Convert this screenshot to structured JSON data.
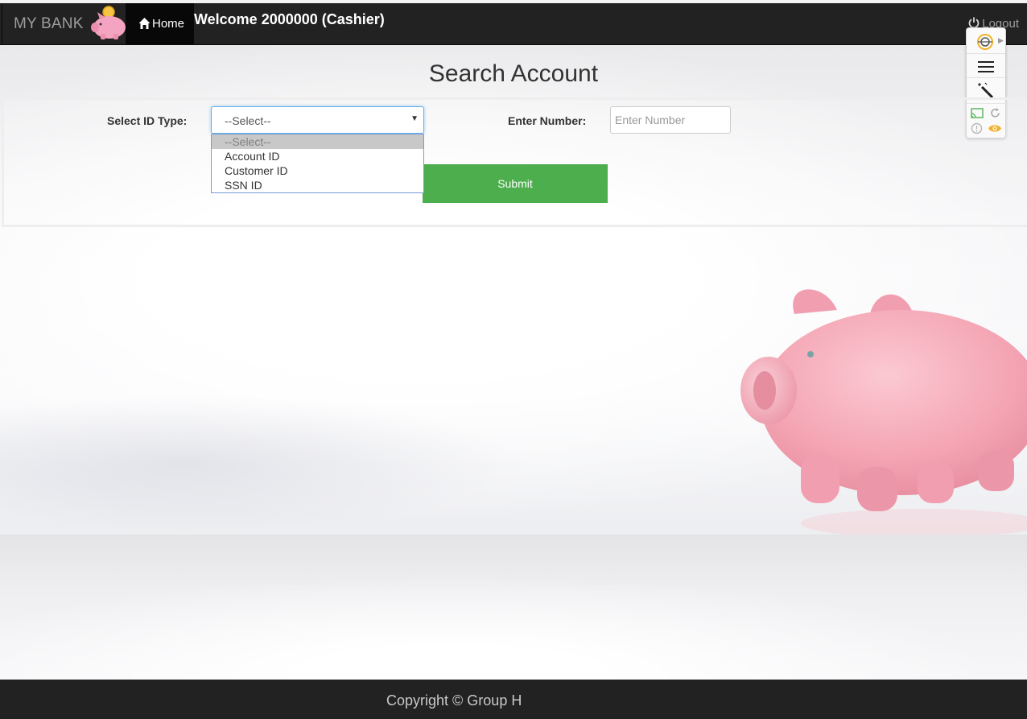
{
  "navbar": {
    "brand": "MY BANK",
    "home_label": "Home",
    "welcome": "Welcome 2000000 (Cashier)",
    "logout_label": "Logout"
  },
  "page": {
    "title": "Search Account"
  },
  "form": {
    "id_type_label": "Select ID Type:",
    "id_type_selected": "--Select--",
    "id_type_options": [
      "--Select--",
      "Account ID",
      "Customer ID",
      "SSN ID"
    ],
    "number_label": "Enter Number:",
    "number_placeholder": "Enter Number",
    "submit_label": "Submit"
  },
  "footer": {
    "copyright": "Copyright © Group H"
  },
  "extension_toolbar": {
    "icons": [
      "globe-icon",
      "menu-icon",
      "magic-wand-icon",
      "cast-icon",
      "refresh-icon",
      "warning-icon",
      "eye-icon"
    ]
  },
  "colors": {
    "navbar_bg": "#222222",
    "submit_green": "#4cae4c",
    "focus_blue": "#66afe9",
    "pig_pink": "#f4a9b8"
  }
}
